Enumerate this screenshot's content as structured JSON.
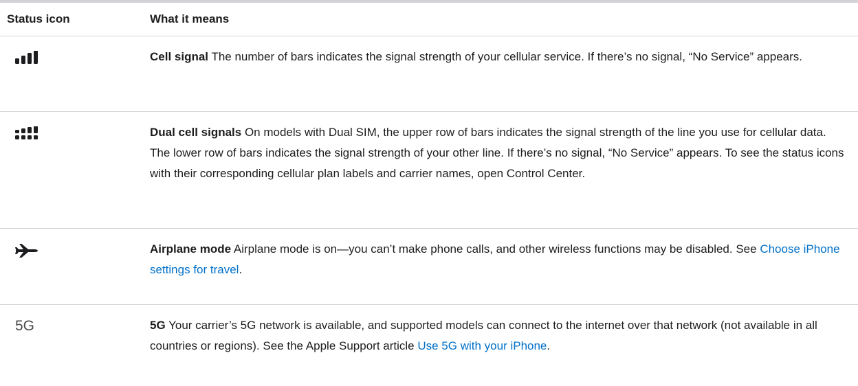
{
  "table": {
    "header": {
      "col_icon": "Status icon",
      "col_meaning": "What it means"
    },
    "rows": [
      {
        "icon": "cell-signal-icon",
        "term": "Cell signal",
        "text": " The number of bars indicates the signal strength of your cellular service. If there’s no signal, “No Service” appears."
      },
      {
        "icon": "dual-cell-signal-icon",
        "term": "Dual cell signals",
        "text": " On models with Dual SIM, the upper row of bars indicates the signal strength of the line you use for cellular data. The lower row of bars indicates the signal strength of your other line. If there’s no signal, “No Service” appears. To see the status icons with their corresponding cellular plan labels and carrier names, open Control Center."
      },
      {
        "icon": "airplane-icon",
        "term": "Airplane mode",
        "text": " Airplane mode is on—you can’t make phone calls, and other wireless functions may be disabled. See ",
        "link": "Choose iPhone settings for travel",
        "after": "."
      },
      {
        "icon": "5g-icon",
        "icon_text": "5G",
        "term": "5G",
        "text": " Your carrier’s 5G network is available, and supported models can connect to the internet over that network (not available in all countries or regions). See the Apple Support article ",
        "link": "Use 5G with your iPhone",
        "after": "."
      }
    ]
  },
  "colors": {
    "link": "#0070c9",
    "text": "#1d1d1f",
    "divider": "#d2d2d7"
  }
}
